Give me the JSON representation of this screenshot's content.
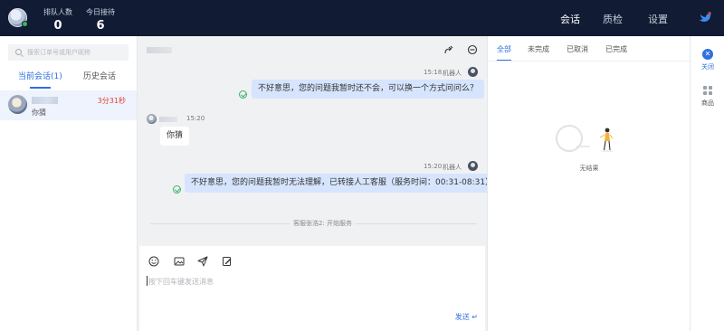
{
  "header": {
    "queue_label": "排队人数",
    "queue_count": "0",
    "today_label": "今日接待",
    "today_count": "6",
    "nav": [
      "会话",
      "质检",
      "设置"
    ]
  },
  "sidebar": {
    "search_placeholder": "搜索订单号或用户昵称",
    "tabs": [
      "当前会话(1)",
      "历史会话"
    ],
    "conversations": [
      {
        "message": "你猜",
        "duration": "3分31秒"
      }
    ]
  },
  "chat": {
    "messages": [
      {
        "from": "bot",
        "time": "15:18",
        "sender": "机器人",
        "text": "不好意思，您的问题我暂时还不会，可以换一个方式问问么？"
      },
      {
        "from": "user",
        "time": "15:20",
        "text": "你猜"
      },
      {
        "from": "bot",
        "time": "15:20",
        "sender": "机器人",
        "text": "不好意思，您的问题我暂时无法理解，已转接人工客服（服务时间：00:31-08:31）"
      }
    ],
    "system_notice": "客服张浩2: 开始服务",
    "input_placeholder": "按下回车键发送消息",
    "send_label": "发送"
  },
  "orders": {
    "tabs": [
      "全部",
      "未完成",
      "已取消",
      "已完成"
    ],
    "empty_text": "无结果"
  },
  "rail": {
    "close_label": "关闭",
    "goods_label": "商品"
  },
  "colors": {
    "topbar": "#111b33",
    "accent": "#2f6fe0",
    "bubble": "#d6e5fd",
    "timer": "#e0443a"
  }
}
